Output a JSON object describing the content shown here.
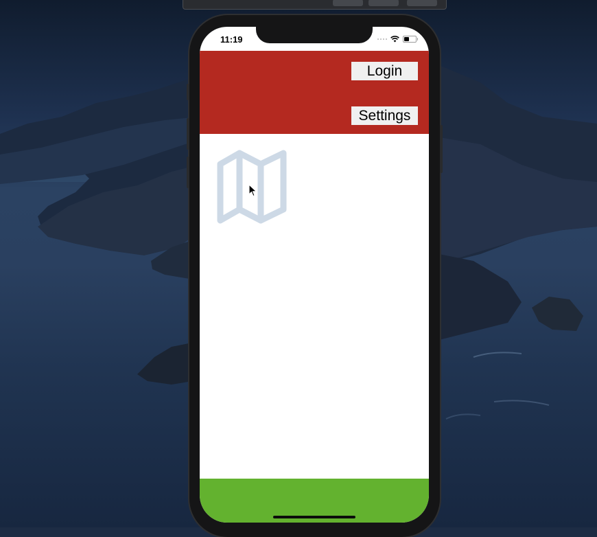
{
  "simulator": {
    "status_bar": {
      "time": "11:19",
      "icons": [
        "cellular-signal-icon",
        "wifi-icon",
        "battery-icon"
      ]
    },
    "header": {
      "background_color": "#b42920",
      "login_label": "Login",
      "settings_label": "Settings"
    },
    "content": {
      "icon": "map-icon",
      "icon_color": "#cdd9e6"
    },
    "footer": {
      "background_color": "#63b22f"
    }
  }
}
